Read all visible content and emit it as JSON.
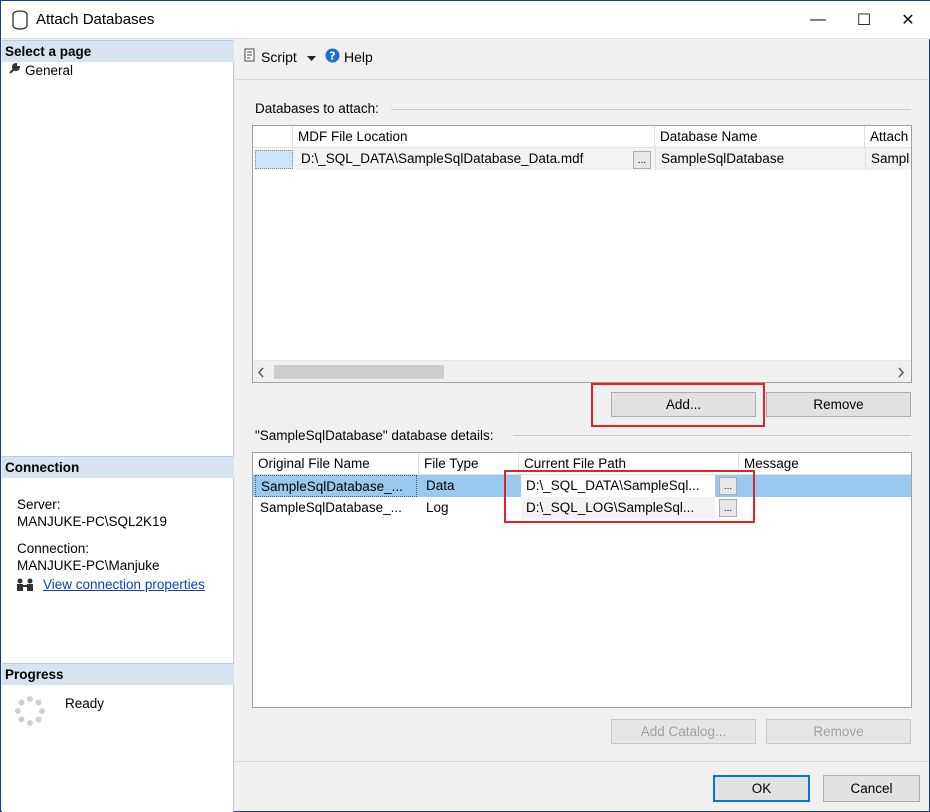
{
  "window": {
    "title": "Attach Databases",
    "controls": {
      "minimize": "—",
      "maximize": "☐",
      "close": "✕"
    }
  },
  "sidebar": {
    "select_page_header": "Select a page",
    "pages": [
      {
        "label": "General",
        "icon": "wrench-icon"
      }
    ],
    "connection_header": "Connection",
    "server_label": "Server:",
    "server_value": "MANJUKE-PC\\SQL2K19",
    "connection_label": "Connection:",
    "connection_value": "MANJUKE-PC\\Manjuke",
    "view_connection_link": "View connection properties",
    "progress_header": "Progress",
    "progress_status": "Ready"
  },
  "toolbar": {
    "script_label": "Script",
    "help_label": "Help"
  },
  "attach": {
    "group_label": "Databases to attach:",
    "columns": [
      "",
      "MDF File Location",
      "Database Name",
      "Attach"
    ],
    "rows": [
      {
        "mdf": "D:\\_SQL_DATA\\SampleSqlDatabase_Data.mdf",
        "browse": "...",
        "db_name": "SampleSqlDatabase",
        "attach_as": "Sampl"
      }
    ],
    "add_button": "Add...",
    "remove_button": "Remove"
  },
  "details": {
    "group_label": "\"SampleSqlDatabase\" database details:",
    "columns": [
      "Original File Name",
      "File Type",
      "Current File Path",
      "Message"
    ],
    "rows": [
      {
        "original": "SampleSqlDatabase_...",
        "type": "Data",
        "path": "D:\\_SQL_DATA\\SampleSql...",
        "browse": "...",
        "message": ""
      },
      {
        "original": "SampleSqlDatabase_...",
        "type": "Log",
        "path": "D:\\_SQL_LOG\\SampleSql...",
        "browse": "...",
        "message": ""
      }
    ],
    "add_catalog_button": "Add Catalog...",
    "remove_button": "Remove"
  },
  "footer": {
    "ok_button": "OK",
    "cancel_button": "Cancel"
  },
  "colors": {
    "highlight_box": "#e0232b",
    "section_header": "#d7e3f1",
    "selected_row": "#99c9ef",
    "link": "#0645ad"
  }
}
